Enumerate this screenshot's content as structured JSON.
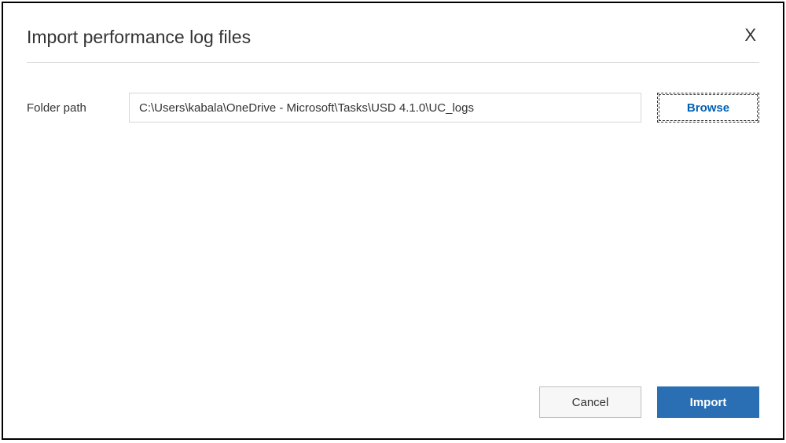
{
  "dialog": {
    "title": "Import performance log files",
    "close_label": "X"
  },
  "form": {
    "folder_path_label": "Folder path",
    "folder_path_value": "C:\\Users\\kabala\\OneDrive - Microsoft\\Tasks\\USD 4.1.0\\UC_logs",
    "browse_label": "Browse"
  },
  "footer": {
    "cancel_label": "Cancel",
    "import_label": "Import"
  }
}
